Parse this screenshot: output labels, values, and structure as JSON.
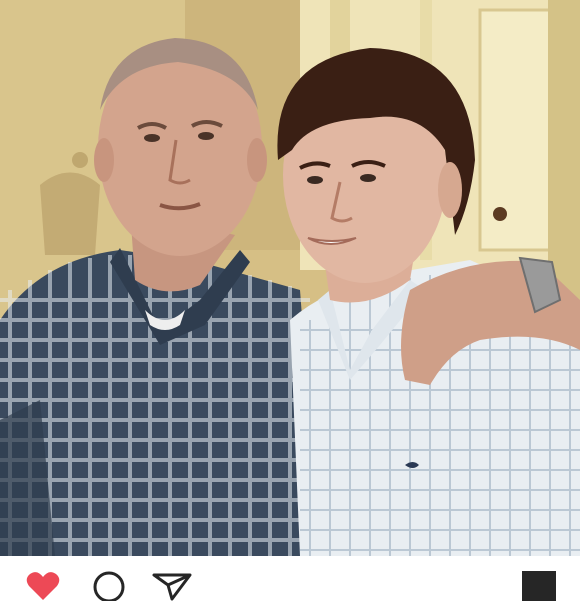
{
  "post": {
    "image": {
      "icon": "photo-two-people-icon"
    },
    "actions": {
      "like": {
        "icon": "heart-icon",
        "active": true,
        "color": "#ed4956"
      },
      "comment": {
        "icon": "comment-icon"
      },
      "share": {
        "icon": "direct-share-icon"
      },
      "save": {
        "icon": "bookmark-icon"
      }
    }
  }
}
